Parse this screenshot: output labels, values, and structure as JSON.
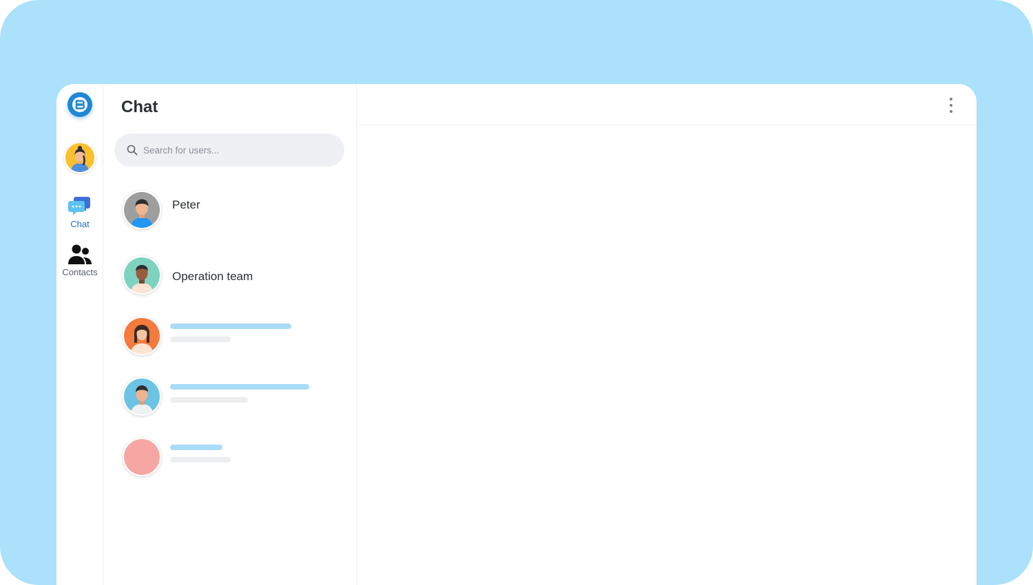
{
  "colors": {
    "frame_background": "#abe1fb",
    "accent": "#1e88d6",
    "skeleton_blue": "#a9dcf6",
    "skeleton_grey": "#eceef0"
  },
  "rail": {
    "logo_icon": "brand-b-logo-icon",
    "profile_icon": "user-avatar",
    "items": [
      {
        "label": "Chat",
        "icon": "chat-bubbles-icon",
        "active": true
      },
      {
        "label": "Contacts",
        "icon": "people-icon",
        "active": false
      }
    ]
  },
  "chat_list": {
    "title": "Chat",
    "search": {
      "placeholder": "Search for users...",
      "value": "",
      "icon": "search-icon"
    },
    "conversations": [
      {
        "name": "Peter",
        "avatar_color": "#9e9e9e"
      },
      {
        "name": "Operation team",
        "avatar_color": "#7dd3c0"
      }
    ],
    "placeholders": [
      {
        "avatar_color": "#f47a3e"
      },
      {
        "avatar_color": "#6cc3e6"
      },
      {
        "avatar_color": "#f7a7a3"
      }
    ]
  },
  "main": {
    "menu_icon": "more-vertical-icon"
  }
}
